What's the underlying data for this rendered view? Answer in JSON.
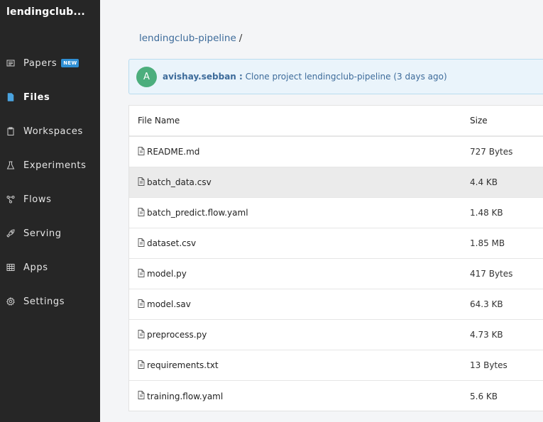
{
  "sidebar": {
    "brand": "lendingclub...",
    "items": [
      {
        "label": "Papers",
        "icon": "newspaper-icon",
        "badge": "NEW"
      },
      {
        "label": "Files",
        "icon": "file-icon",
        "active": true
      },
      {
        "label": "Workspaces",
        "icon": "clipboard-icon"
      },
      {
        "label": "Experiments",
        "icon": "flask-icon"
      },
      {
        "label": "Flows",
        "icon": "flow-icon"
      },
      {
        "label": "Serving",
        "icon": "rocket-icon"
      },
      {
        "label": "Apps",
        "icon": "grid-icon"
      },
      {
        "label": "Settings",
        "icon": "gear-icon"
      }
    ]
  },
  "breadcrumb": {
    "project": "lendingclub-pipeline",
    "separator": "/"
  },
  "commit": {
    "avatar_letter": "A",
    "user": "avishay.sebban :",
    "message": "Clone project lendingclub-pipeline (3 days ago)"
  },
  "table": {
    "headers": {
      "name": "File Name",
      "size": "Size"
    },
    "rows": [
      {
        "name": "README.md",
        "size": "727 Bytes"
      },
      {
        "name": "batch_data.csv",
        "size": "4.4 KB"
      },
      {
        "name": "batch_predict.flow.yaml",
        "size": "1.48 KB"
      },
      {
        "name": "dataset.csv",
        "size": "1.85 MB"
      },
      {
        "name": "model.py",
        "size": "417 Bytes"
      },
      {
        "name": "model.sav",
        "size": "64.3 KB"
      },
      {
        "name": "preprocess.py",
        "size": "4.73 KB"
      },
      {
        "name": "requirements.txt",
        "size": "13 Bytes"
      },
      {
        "name": "training.flow.yaml",
        "size": "5.6 KB"
      }
    ]
  }
}
